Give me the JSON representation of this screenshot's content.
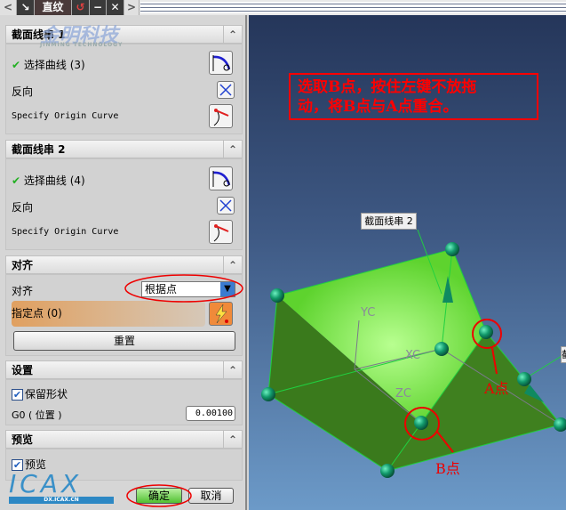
{
  "titlebar": {
    "prev": "<",
    "title": "直纹",
    "next": ">",
    "icons": [
      "select-arrow-icon",
      "undo-icon",
      "minimize-icon",
      "close-icon"
    ]
  },
  "watermark": {
    "company": "金明科技",
    "tagline": "JINMING TECHNOLOGY",
    "site": "DX.ICAX.CN",
    "logo": "ICAX"
  },
  "sections": {
    "s1": {
      "title": "截面线串 1",
      "select": "选择曲线 (3)",
      "reverse": "反向",
      "origin": "Specify Origin Curve"
    },
    "s2": {
      "title": "截面线串 2",
      "select": "选择曲线 (4)",
      "reverse": "反向",
      "origin": "Specify Origin Curve"
    },
    "align": {
      "title": "对齐",
      "label": "对齐",
      "value": "根据点",
      "point": "指定点 (0)",
      "reset": "重置"
    },
    "settings": {
      "title": "设置",
      "keep_shape": "保留形状",
      "g0_label": "G0 ( 位置 )",
      "g0_value": "0.00100"
    },
    "preview": {
      "title": "预览",
      "preview": "预览"
    }
  },
  "buttons": {
    "ok": "确定",
    "cancel": "取消"
  },
  "viewport": {
    "note_line1": "选取B点，按住左键不放拖",
    "note_line2": "动，将B点与A点重合。",
    "label_s2": "截面线串 2",
    "label_cut": "截",
    "yc": "YC",
    "xc": "XC",
    "zc": "ZC",
    "a_point": "A点",
    "b_point": "B点",
    "colors": {
      "top_face": "#5ed32e",
      "dark_face": "#3d7d1e",
      "sphere": "#1a9a70",
      "annotation": "#ff0000"
    }
  }
}
